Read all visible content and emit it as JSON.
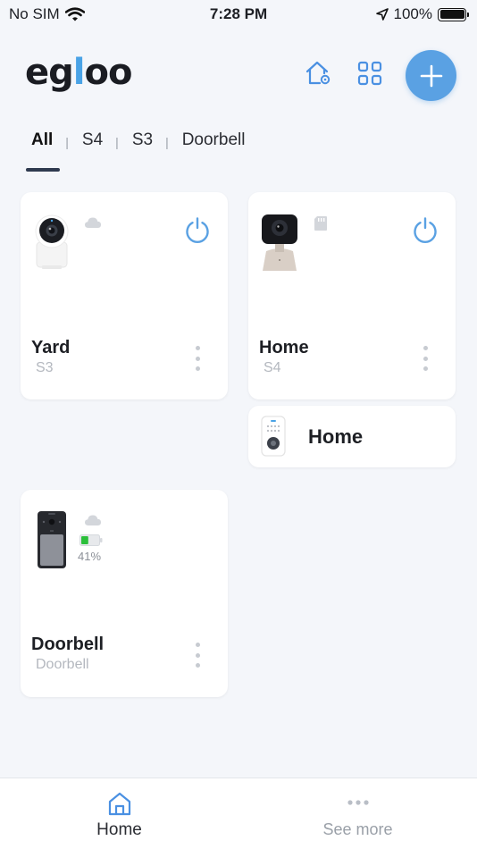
{
  "status_bar": {
    "carrier": "No SIM",
    "time": "7:28 PM",
    "battery_pct": "100%"
  },
  "header": {
    "logo_text_pre": "eg",
    "logo_text_i": "l",
    "logo_text_post": "oo",
    "icons": [
      "home-settings-icon",
      "grid-icon",
      "plus-icon"
    ],
    "accent_color": "#5aa1e3"
  },
  "tabs": {
    "items": [
      "All",
      "S4",
      "S3",
      "Doorbell"
    ],
    "separator": "|",
    "active": "All"
  },
  "devices": [
    {
      "name": "Yard",
      "model": "S3",
      "status_icon": "cloud-icon",
      "has_power": true
    },
    {
      "name": "Home",
      "model": "S4",
      "status_icon": "sd-card-icon",
      "has_power": true
    },
    {
      "name": "Home",
      "type": "chime"
    },
    {
      "name": "Doorbell",
      "model": "Doorbell",
      "status_icon": "cloud-icon",
      "battery": "41%",
      "battery_level": 0.41,
      "battery_color": "#2bbf3a"
    }
  ],
  "bottom_nav": {
    "home_label": "Home",
    "more_label": "See more"
  }
}
